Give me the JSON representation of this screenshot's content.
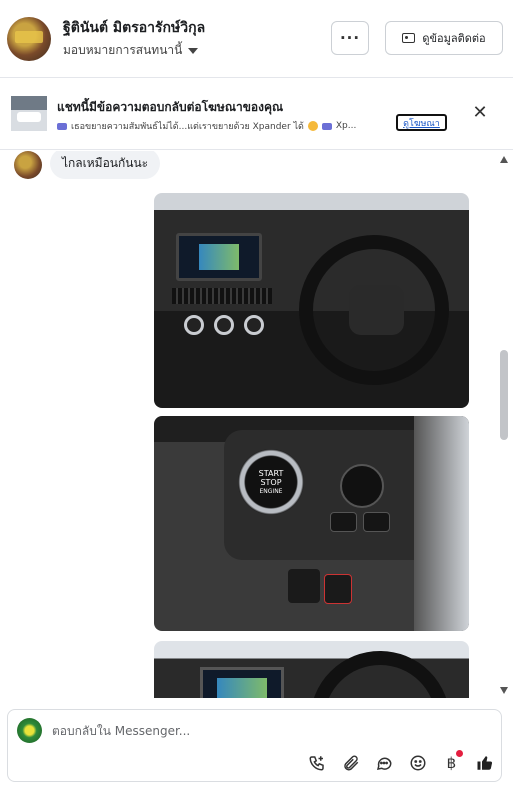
{
  "header": {
    "contact_name": "ฐิตินันต์ มิตรอารักษ์วิกุล",
    "assign_label": "มอบหมายการสนทนานี้",
    "more_label": "···",
    "contact_info_label": "ดูข้อมูลติดต่อ"
  },
  "ad_banner": {
    "title": "แชทนี้มีข้อความตอบกลับต่อโฆษณาของคุณ",
    "preview_part1": "เธอขยายความสัมพันธ์ไม่ได้...แต่เราขยายด้วย Xpander ได้",
    "preview_part2": "Xp...",
    "link_label": "ดูโฆษณา"
  },
  "thread": {
    "messages": [
      {
        "text": "ไกลเหมือนกันนะ"
      }
    ],
    "photo2_start_text": [
      "START",
      "STOP",
      "ENGINE"
    ]
  },
  "composer": {
    "placeholder": "ตอบกลับใน Messenger...",
    "tools": [
      "phone-plus-icon",
      "paperclip-icon",
      "chat-bubble-icon",
      "emoji-icon",
      "baht-icon",
      "thumbs-up-icon"
    ]
  }
}
